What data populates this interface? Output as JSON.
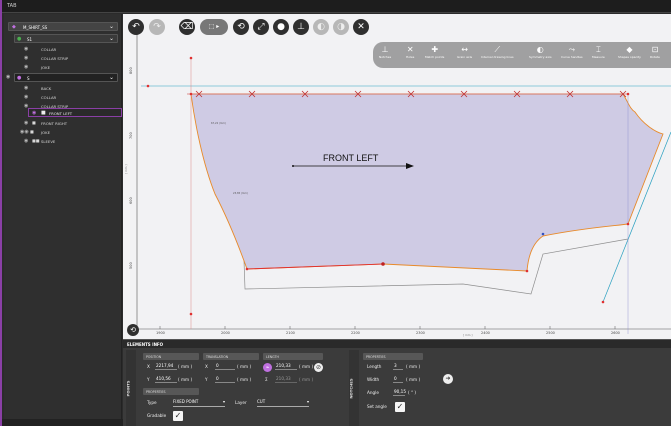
{
  "app": {
    "title": "TAB"
  },
  "tree": {
    "root_label": "M_SHIRT_SS",
    "group1_label": "S1",
    "group1_items": [
      "COLLAR",
      "COLLAR STRIP",
      "JOKE"
    ],
    "group2_label": "S",
    "group2_items": [
      "BACK",
      "COLLAR",
      "COLLAR STRIP",
      "FRONT LEFT",
      "FRONT RIGHT",
      "JOKE",
      "SLEEVE"
    ]
  },
  "toolbar": {
    "icons": [
      "undo-icon",
      "redo-icon",
      "eraser-icon",
      "select-mode-icon",
      "rotate-icon",
      "line-tool-icon",
      "point-tool-icon",
      "notch-tool-icon",
      "mirror-icon",
      "contrast-icon",
      "close-icon"
    ]
  },
  "tool_panel": {
    "tools": [
      {
        "label": "Notches",
        "icon": "notch-icon"
      },
      {
        "label": "Holes",
        "icon": "hole-icon"
      },
      {
        "label": "Match points",
        "icon": "match-points-icon"
      },
      {
        "label": "Grain axis",
        "icon": "grain-axis-icon"
      },
      {
        "label": "Internal drawing lines",
        "icon": "internal-lines-icon"
      },
      {
        "label": "Symmetry axis",
        "icon": "symmetry-axis-icon"
      },
      {
        "label": "Curve handles",
        "icon": "curve-handles-icon"
      },
      {
        "label": "Measure",
        "icon": "measure-icon"
      },
      {
        "label": "Shapes opacity",
        "icon": "opacity-icon"
      },
      {
        "label": "Rotate",
        "icon": "rotate-icon"
      }
    ]
  },
  "canvas": {
    "piece_label": "FRONT LEFT",
    "piece_fill": "#cfcbe4",
    "outline_color": "#e88a2a",
    "construction_color": "#2aa0c0",
    "point_color": "#e03030",
    "x_ticks": [
      "1900",
      "2000",
      "2100",
      "2200",
      "2300",
      "2400",
      "2500",
      "2600"
    ],
    "y_ticks": [
      "500",
      "600",
      "700",
      "800"
    ],
    "x_unit": "[ mm ]",
    "y_unit": "[ mm ]"
  },
  "elements_info": {
    "title": "ELEMENTS INFO",
    "points_tab": "POINTS",
    "notches_tab": "NOTCHES",
    "position_header": "POSITION",
    "translation_header": "TRANSLATION",
    "length_header": "LENGTH",
    "properties_header": "PROPERTIES",
    "x_label": "X",
    "y_label": "Y",
    "pos_x": "2217,94",
    "pos_y": "410,56",
    "unit_mm": "( mm )",
    "trans_x": "0",
    "trans_y": "0",
    "length_val": "210,33",
    "sum_val": "210,33",
    "type_label": "Type",
    "type_value": "FIXED POINT",
    "layer_label": "Layer",
    "layer_value": "CUT",
    "gradable_label": "Gradable",
    "notch_properties_header": "PROPERTIES",
    "notch_length_label": "Length",
    "notch_length_value": "3",
    "notch_width_label": "Width",
    "notch_width_value": "0",
    "notch_angle_label": "Angle",
    "notch_angle_value": "90,15",
    "notch_angle_unit": "( ° )",
    "set_angle_label": "Set angle"
  }
}
